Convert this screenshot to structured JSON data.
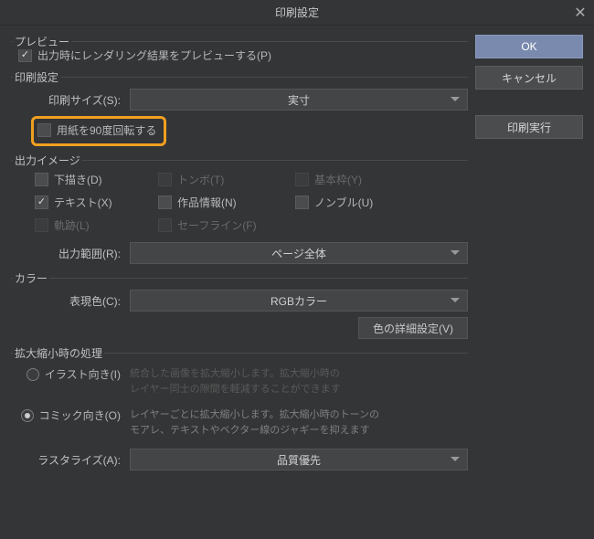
{
  "title": "印刷設定",
  "buttons": {
    "ok": "OK",
    "cancel": "キャンセル",
    "print_exec": "印刷実行",
    "color_detail": "色の詳細設定(V)"
  },
  "preview": {
    "legend": "プレビュー",
    "render_on_output": "出力時にレンダリング結果をプレビューする(P)"
  },
  "print_settings": {
    "legend": "印刷設定",
    "size_label": "印刷サイズ(S):",
    "size_value": "実寸",
    "rotate90": "用紙を90度回転する"
  },
  "output_image": {
    "legend": "出力イメージ",
    "draft": "下描き(D)",
    "tombo": "トンボ(T)",
    "basic_frame": "基本枠(Y)",
    "text": "テキスト(X)",
    "work_info": "作品情報(N)",
    "nombre": "ノンブル(U)",
    "trajectory": "軌跡(L)",
    "safeline": "セーフライン(F)",
    "range_label": "出力範囲(R):",
    "range_value": "ページ全体"
  },
  "color": {
    "legend": "カラー",
    "expr_label": "表現色(C):",
    "expr_value": "RGBカラー"
  },
  "scaling": {
    "legend": "拡大縮小時の処理",
    "illust_label": "イラスト向き(I)",
    "illust_desc1": "統合した画像を拡大縮小します。拡大縮小時の",
    "illust_desc2": "レイヤー同士の隙間を軽減することができます",
    "comic_label": "コミック向き(O)",
    "comic_desc1": "レイヤーごとに拡大縮小します。拡大縮小時のトーンの",
    "comic_desc2": "モアレ、テキストやベクター線のジャギーを抑えます",
    "rasterize_label": "ラスタライズ(A):",
    "rasterize_value": "品質優先"
  }
}
